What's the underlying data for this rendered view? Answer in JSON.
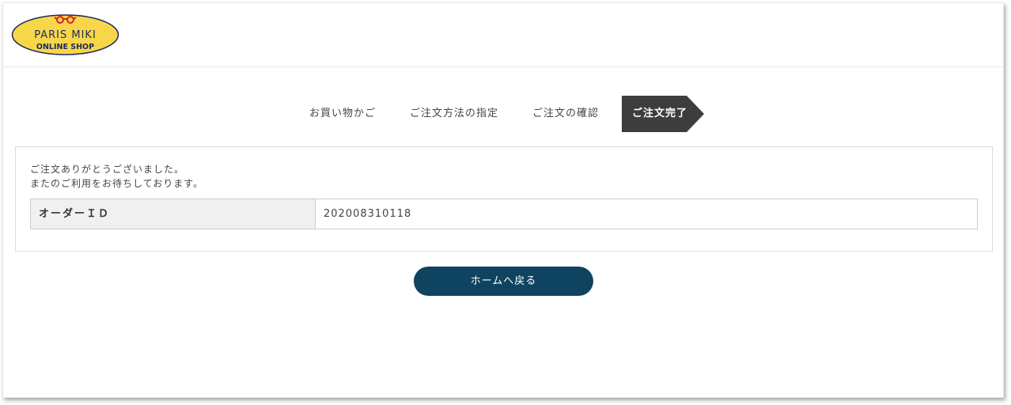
{
  "logo": {
    "line1": "PARIS MIKI",
    "line2": "ONLINE SHOP",
    "colors": {
      "fill": "#f7d64a",
      "text": "#1d2a5a",
      "glasses": "#d9232e"
    }
  },
  "steps": [
    {
      "label": "お買い物かご",
      "active": false
    },
    {
      "label": "ご注文方法の指定",
      "active": false
    },
    {
      "label": "ご注文の確認",
      "active": false
    },
    {
      "label": "ご注文完了",
      "active": true
    }
  ],
  "message": {
    "line1": "ご注文ありがとうございました。",
    "line2": "またのご利用をお待ちしております。"
  },
  "order": {
    "label": "オーダーＩＤ",
    "value": "202008310118"
  },
  "home_button": {
    "label": "ホームへ戻る"
  },
  "colors": {
    "active_step_bg": "#3d3d3d",
    "button_bg": "#0f4461",
    "label_bg": "#f0f0f0"
  }
}
